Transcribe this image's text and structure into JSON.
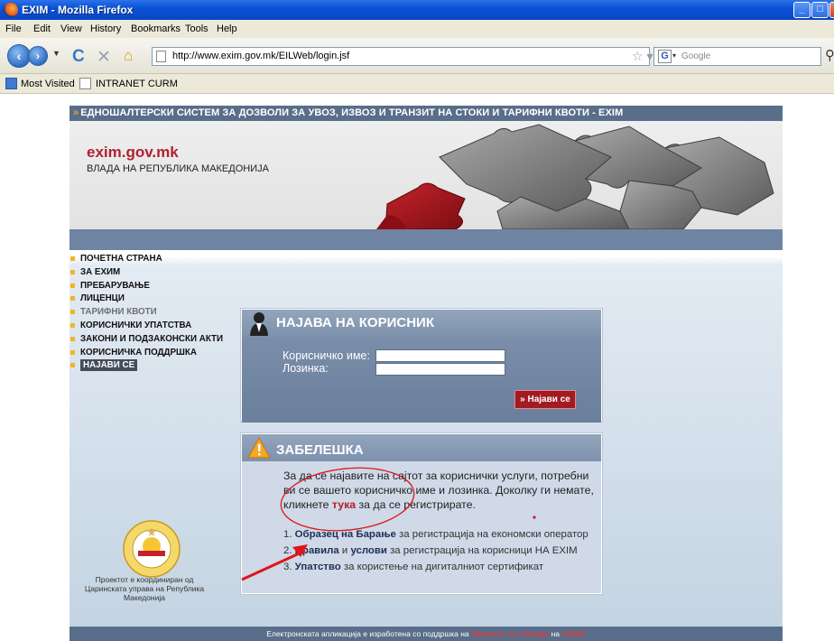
{
  "browser": {
    "window_title": "EXIM - Mozilla Firefox",
    "menu": [
      "File",
      "Edit",
      "View",
      "History",
      "Bookmarks",
      "Tools",
      "Help"
    ],
    "url": "http://www.exim.gov.mk/EILWeb/login.jsf",
    "search_placeholder": "Google",
    "bookmarks": [
      "Most Visited",
      "INTRANET CURM"
    ]
  },
  "site": {
    "top_strip": "ЕДНОШАЛТЕРСКИ СИСТЕМ ЗА ДОЗВОЛИ ЗА УВОЗ, ИЗВОЗ И ТРАНЗИТ НА СТОКИ И ТАРИФНИ КВОТИ - EXIM",
    "name": "exim.gov.mk",
    "subtitle": "ВЛАДА НА РЕПУБЛИКА МАКЕДОНИЈА",
    "menu": [
      {
        "label": "ПОЧЕТНА СТРАНА",
        "state": "normal"
      },
      {
        "label": "ЗА EXИМ",
        "state": "normal"
      },
      {
        "label": "ПРЕБАРУВАЊЕ",
        "state": "normal"
      },
      {
        "label": "ЛИЦЕНЦИ",
        "state": "normal"
      },
      {
        "label": "ТАРИФНИ КВОТИ",
        "state": "gray"
      },
      {
        "label": "КОРИСНИЧКИ УПАТСТВА",
        "state": "normal"
      },
      {
        "label": "ЗАКОНИ И ПОДЗАКОНСКИ АКТИ",
        "state": "normal"
      },
      {
        "label": "КОРИСНИЧКА ПОДДРШКА",
        "state": "normal"
      },
      {
        "label": "НАЈАВИ СЕ",
        "state": "active"
      }
    ],
    "footnote": "Проектот е координиран од Царинската управа на Република Македонија",
    "seal_text": "РЕПУБЛИКА МАКЕДОНИЈА · ЦАРИНА · CUSTOMS"
  },
  "login": {
    "title": "НАЈАВА НА КОРИСНИК",
    "username_label": "Корисничко име:",
    "password_label": "Лозинка:",
    "username_value": "",
    "password_value": "",
    "button": "Најави се",
    "button_prefix": "»"
  },
  "note": {
    "title": "ЗАБЕЛЕШКА",
    "text_before": "За да се најавите на сајтот за кориснички услуги, потребни ви се вашето корисничко име и лозинка. Доколку ги немате, кликнете",
    "link": "тука",
    "text_after": "за да се регистрирате.",
    "items": [
      {
        "num": "1.",
        "link": "Образец на Барање",
        "rest": "за регистрација на економски оператор"
      },
      {
        "num": "2.",
        "link": "Правила",
        "mid": "и",
        "link2": "услови",
        "rest": "за регистрација на корисници НА EXIM"
      },
      {
        "num": "3.",
        "link": "Упатство",
        "rest": "за користење на дигиталниот сертификат"
      }
    ]
  },
  "footer": {
    "text": "Електронската апликација е изработена со поддршка на",
    "project": "Проектот за е-Влада",
    "connector": "на",
    "usaid": "USAID"
  },
  "colors": {
    "accent_red": "#b3202f",
    "header_blue": "#586e8a",
    "annotation_red": "#e0141b"
  }
}
